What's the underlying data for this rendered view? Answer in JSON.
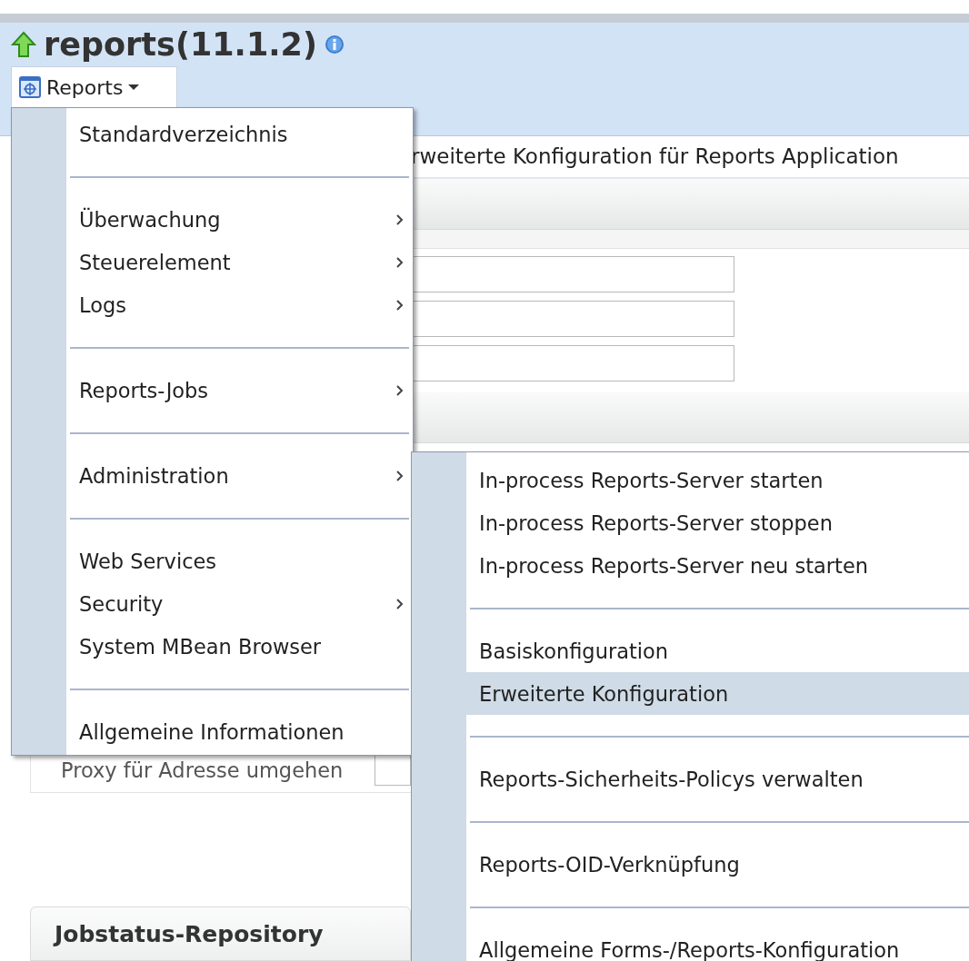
{
  "header": {
    "title": "reports(11.1.2)",
    "menu_button": "Reports"
  },
  "page": {
    "heading": "rweiterte Konfiguration für Reports Application",
    "proxy_label": "Proxy für Adresse umgehen",
    "section_title": "Jobstatus-Repository"
  },
  "menu": {
    "items": [
      {
        "kind": "item",
        "label": "Standardverzeichnis",
        "submenu": false
      },
      {
        "kind": "separator"
      },
      {
        "kind": "item",
        "label": "Überwachung",
        "submenu": true
      },
      {
        "kind": "item",
        "label": "Steuerelement",
        "submenu": true
      },
      {
        "kind": "item",
        "label": "Logs",
        "submenu": true
      },
      {
        "kind": "separator"
      },
      {
        "kind": "item",
        "label": "Reports-Jobs",
        "submenu": true
      },
      {
        "kind": "separator"
      },
      {
        "kind": "item",
        "label": "Administration",
        "submenu": true
      },
      {
        "kind": "separator"
      },
      {
        "kind": "item",
        "label": "Web Services",
        "submenu": false
      },
      {
        "kind": "item",
        "label": "Security",
        "submenu": true
      },
      {
        "kind": "item",
        "label": "System MBean Browser",
        "submenu": false
      },
      {
        "kind": "separator"
      },
      {
        "kind": "item",
        "label": "Allgemeine Informationen",
        "submenu": false
      }
    ]
  },
  "submenu": {
    "items": [
      {
        "kind": "item",
        "label": "In-process Reports-Server starten",
        "selected": false
      },
      {
        "kind": "item",
        "label": "In-process Reports-Server stoppen",
        "selected": false
      },
      {
        "kind": "item",
        "label": "In-process Reports-Server neu starten",
        "selected": false
      },
      {
        "kind": "separator"
      },
      {
        "kind": "item",
        "label": "Basiskonfiguration",
        "selected": false
      },
      {
        "kind": "item",
        "label": "Erweiterte Konfiguration",
        "selected": true
      },
      {
        "kind": "separator"
      },
      {
        "kind": "item",
        "label": "Reports-Sicherheits-Policys verwalten",
        "selected": false
      },
      {
        "kind": "separator"
      },
      {
        "kind": "item",
        "label": "Reports-OID-Verknüpfung",
        "selected": false
      },
      {
        "kind": "separator"
      },
      {
        "kind": "item",
        "label": "Allgemeine Forms-/Reports-Konfiguration",
        "selected": false
      }
    ]
  }
}
